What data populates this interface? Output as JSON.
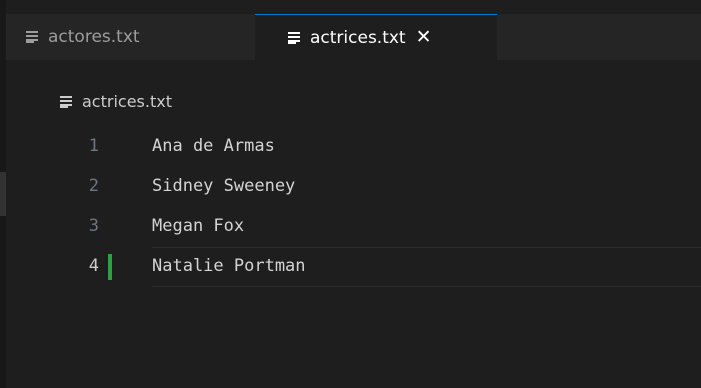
{
  "tabs": [
    {
      "label": "actores.txt",
      "icon": "file-lines-icon",
      "active": false
    },
    {
      "label": "actrices.txt",
      "icon": "file-lines-icon",
      "active": true,
      "close": "✕"
    }
  ],
  "breadcrumb": {
    "file": "actrices.txt",
    "icon": "file-lines-icon"
  },
  "editor": {
    "lines": [
      {
        "number": "1",
        "text": "Ana de Armas"
      },
      {
        "number": "2",
        "text": "Sidney Sweeney"
      },
      {
        "number": "3",
        "text": "Megan Fox"
      },
      {
        "number": "4",
        "text": "Natalie Portman"
      }
    ],
    "active_line": 4
  },
  "colors": {
    "background": "#1e1e1e",
    "tab_accent": "#0078d4",
    "git_added": "#2ea043"
  }
}
